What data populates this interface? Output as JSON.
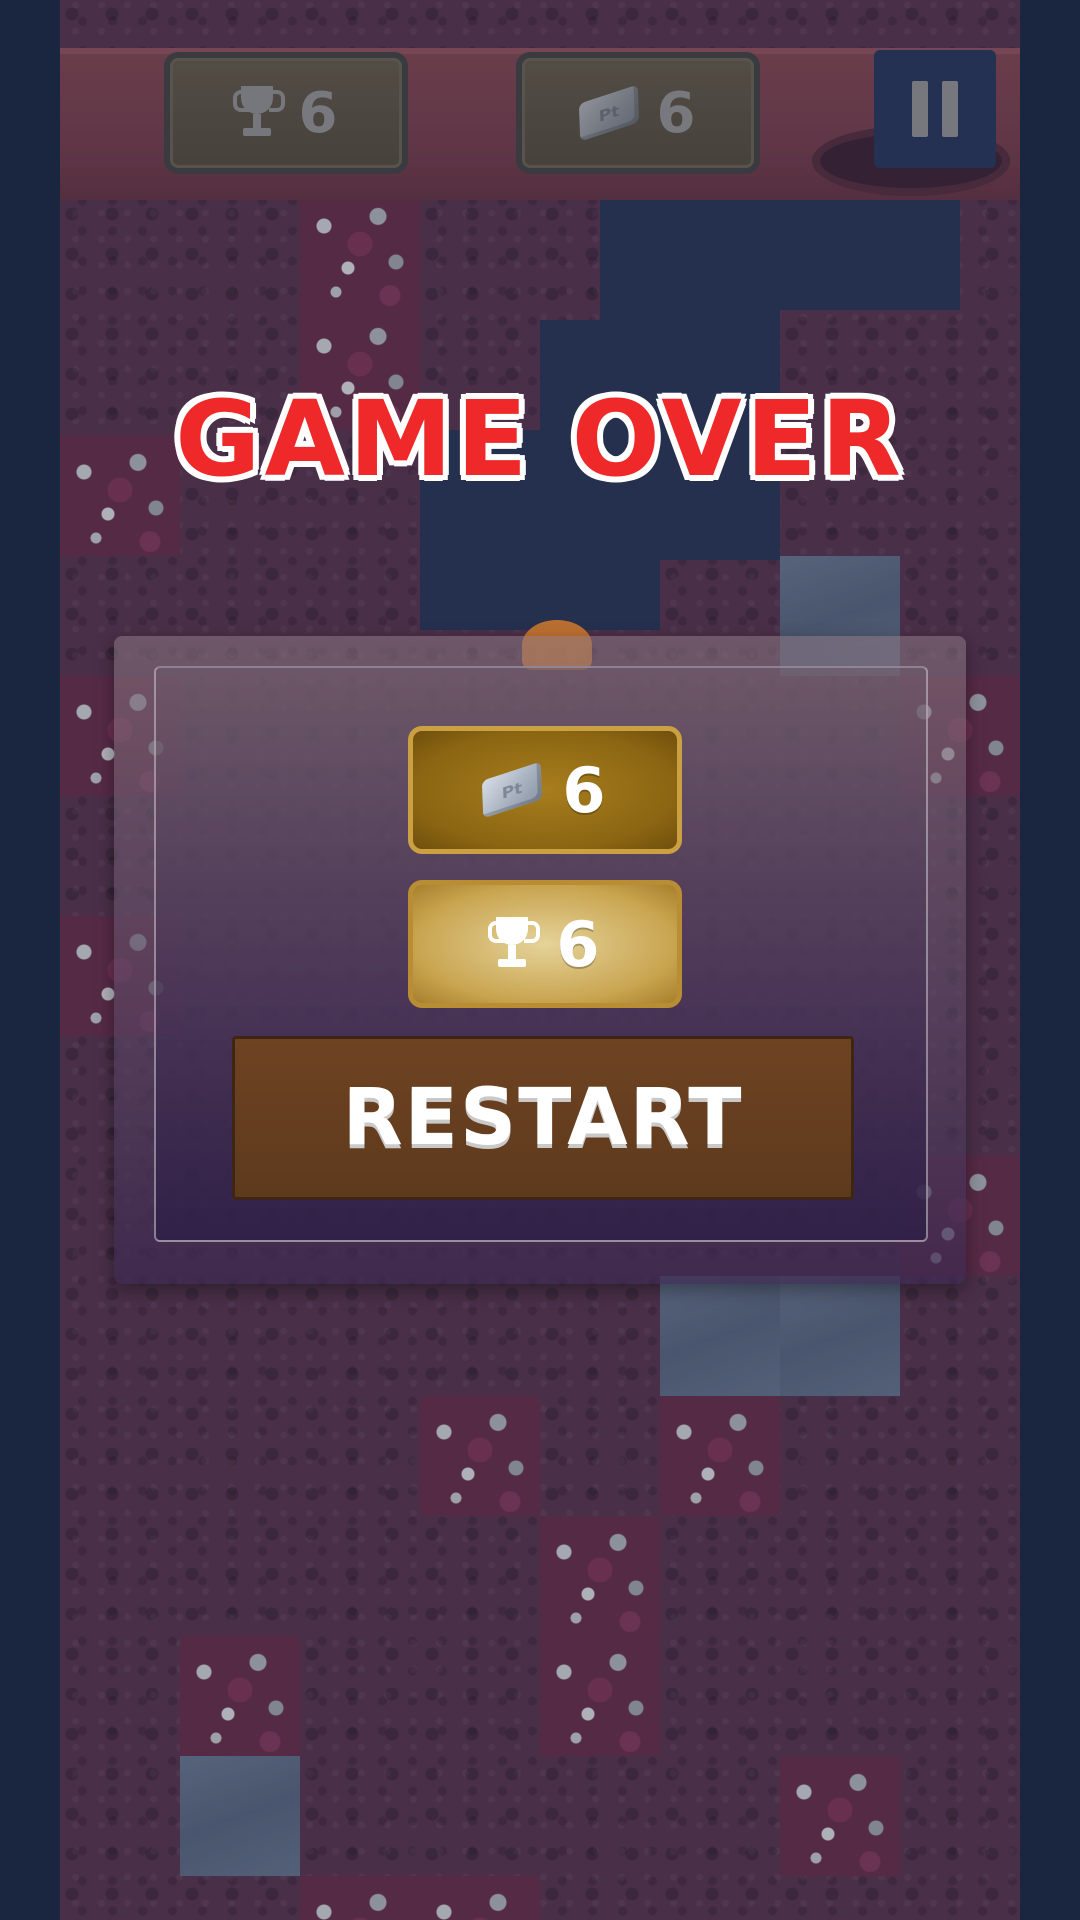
{
  "hud": {
    "best_score": "6",
    "platinum_count": "6",
    "pause_icon": "pause-icon"
  },
  "game_over": {
    "title": "GAME OVER",
    "score_value": "6",
    "best_value": "6",
    "restart_label": "RESTART",
    "ingot_label": "Pt"
  },
  "colors": {
    "title_red": "#ef2929",
    "background": "#1f2c48",
    "dirt": "#5e3a55",
    "button_brown": "#6e4322"
  },
  "icons": [
    "trophy-icon",
    "platinum-ingot-icon",
    "pause-icon"
  ]
}
